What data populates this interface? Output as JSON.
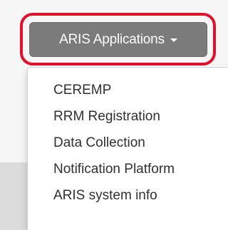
{
  "toolbar": {
    "apps_button_label": "ARIS Applications"
  },
  "dropdown": {
    "items": [
      {
        "label": "CEREMP"
      },
      {
        "label": "RRM Registration"
      },
      {
        "label": "Data Collection"
      },
      {
        "label": "Notification Platform"
      },
      {
        "label": "ARIS system info"
      }
    ]
  },
  "colors": {
    "button_bg": "#7b7b7b",
    "highlight": "#e2102b",
    "menu_text": "#303030"
  }
}
